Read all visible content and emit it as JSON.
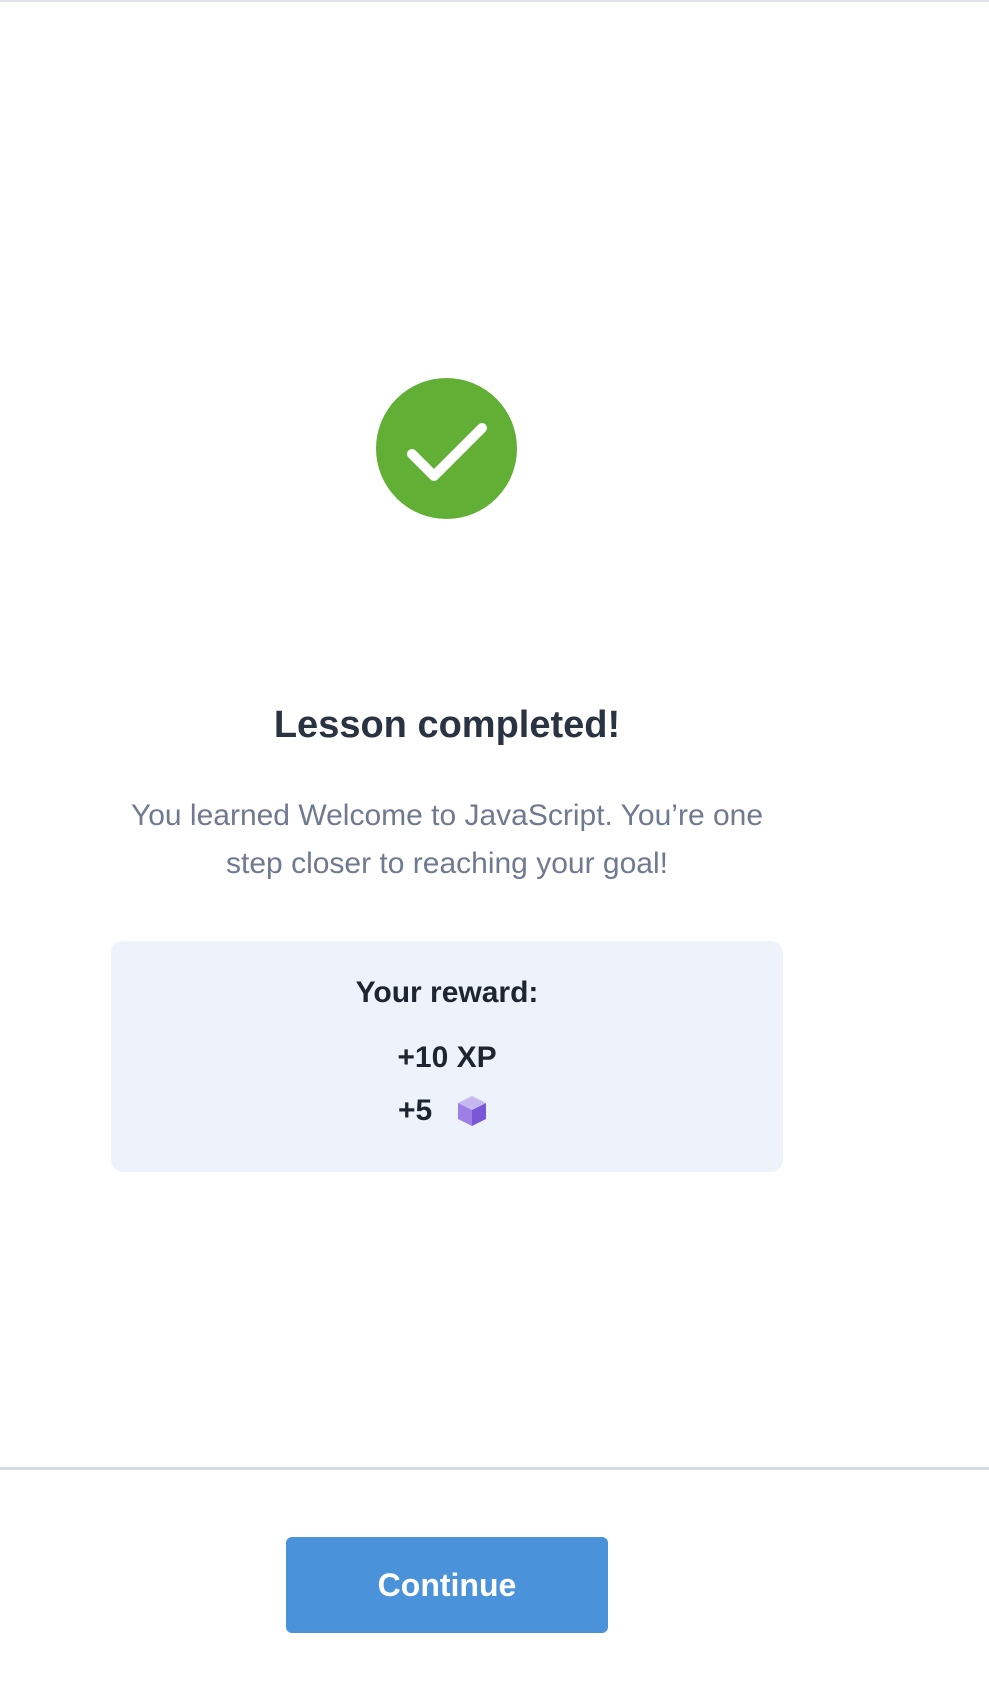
{
  "completion": {
    "icon": "checkmark-icon",
    "badge_color": "#62af35",
    "title": "Lesson completed!",
    "message": "You learned Welcome to JavaScript. You’re one step closer to reaching your goal!"
  },
  "reward": {
    "heading": "Your reward:",
    "xp": "+10 XP",
    "gems": "+5",
    "gem_icon": "purple-cube-gem-icon",
    "box_color": "#edf2fb"
  },
  "footer": {
    "continue_label": "Continue",
    "button_color": "#4a92d9"
  }
}
